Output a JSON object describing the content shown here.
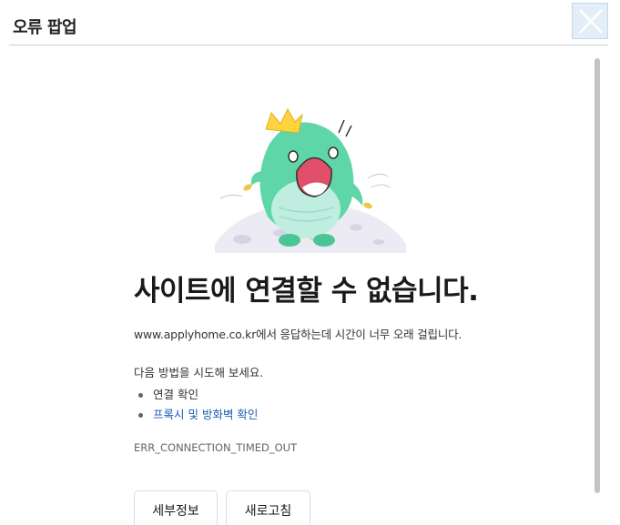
{
  "popup": {
    "title": "오류 팝업",
    "close_icon": "close-x-icon"
  },
  "error": {
    "illustration": "crying-mascot-illustration",
    "heading": "사이트에 연결할 수 없습니다.",
    "message": "www.applyhome.co.kr에서 응답하는데 시간이 너무 오래 걸립니다.",
    "suggest_intro": "다음 방법을 시도해 보세요.",
    "suggestions": [
      {
        "label": "연결 확인",
        "is_link": false
      },
      {
        "label": "프록시 및 방화벽 확인",
        "is_link": true
      }
    ],
    "code": "ERR_CONNECTION_TIMED_OUT"
  },
  "buttons": {
    "details": "세부정보",
    "reload": "새로고침"
  },
  "colors": {
    "link": "#1a5fb4",
    "mascot_green": "#5fd6a8",
    "crown_yellow": "#ffd33d",
    "mouth_red": "#e0506a"
  }
}
